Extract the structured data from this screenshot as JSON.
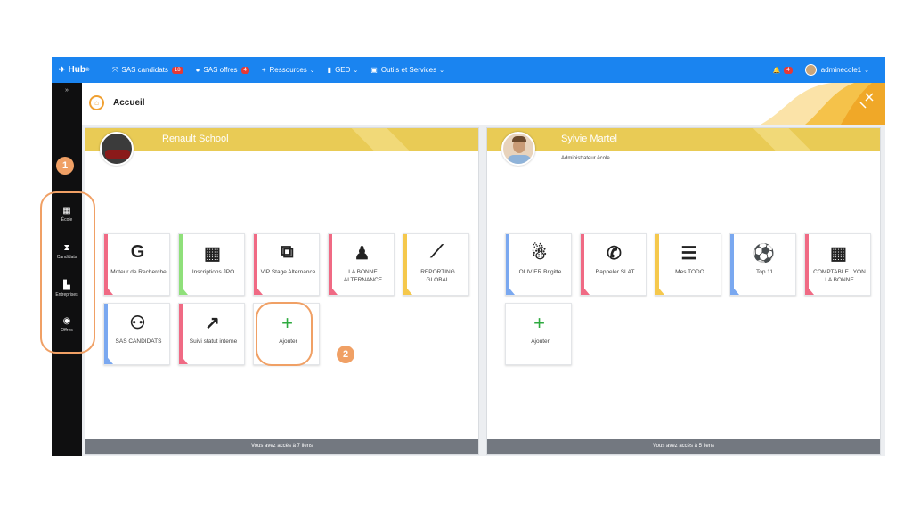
{
  "topbar": {
    "logo": "Hub",
    "logo_sup": "®",
    "nav": [
      {
        "icon": "⤧",
        "label": "SAS candidats",
        "badge": "18",
        "chevron": ""
      },
      {
        "icon": "●",
        "label": "SAS offres",
        "badge": "4",
        "chevron": ""
      },
      {
        "icon": "+",
        "label": "Ressources",
        "badge": "",
        "chevron": "⌄"
      },
      {
        "icon": "▮",
        "label": "GED",
        "badge": "",
        "chevron": "⌄"
      },
      {
        "icon": "▣",
        "label": "Outils et Services",
        "badge": "",
        "chevron": "⌄"
      }
    ],
    "bell_icon": "🔔",
    "bell_badge": "4",
    "user": "adminecole1",
    "user_chevron": "⌄"
  },
  "sidebar": {
    "toggle": "»",
    "items": [
      {
        "icon": "▦",
        "label": "École"
      },
      {
        "icon": "⧗",
        "label": "Candidats"
      },
      {
        "icon": "▙",
        "label": "Entreprises"
      },
      {
        "icon": "◉",
        "label": "Offres"
      }
    ]
  },
  "header": {
    "title": "Accueil"
  },
  "panel_left": {
    "name": "Renault School",
    "tiles": [
      {
        "icon": "G",
        "label": "Moteur de Recherche",
        "color": "#f06a84"
      },
      {
        "icon": "▦",
        "label": "Inscriptions JPO",
        "color": "#8fe07a"
      },
      {
        "icon": "⧉",
        "label": "VIP Stage Alternance",
        "color": "#f06a84"
      },
      {
        "icon": "♟",
        "label": "LA BONNE ALTERNANCE",
        "color": "#f06a84"
      },
      {
        "icon": "⟋",
        "label": "REPORTING GLOBAL",
        "color": "#f5c84c"
      },
      {
        "icon": "⚇",
        "label": "SAS CANDIDATS",
        "color": "#7aa8f0"
      },
      {
        "icon": "↗",
        "label": "Suivi statut interne",
        "color": "#f06a84"
      }
    ],
    "add_label": "Ajouter",
    "footer": "Vous avez accès à 7 liens"
  },
  "panel_right": {
    "name": "Sylvie Martel",
    "subtitle": "Administrateur école",
    "tiles": [
      {
        "icon": "☃",
        "label": "OLIVIER Brigitte",
        "color": "#7aa8f0"
      },
      {
        "icon": "✆",
        "label": "Rappeler SLAT",
        "color": "#f06a84"
      },
      {
        "icon": "☰",
        "label": "Mes TODO",
        "color": "#f5c84c"
      },
      {
        "icon": "⚽",
        "label": "Top 11",
        "color": "#7aa8f0"
      },
      {
        "icon": "▦",
        "label": "COMPTABLE LYON LA BONNE",
        "color": "#f06a84"
      }
    ],
    "add_label": "Ajouter",
    "footer": "Vous avez accès à 5 liens"
  },
  "annotations": [
    "1",
    "2"
  ]
}
